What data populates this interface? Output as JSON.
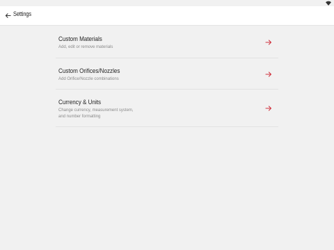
{
  "status_bar": {
    "icons": [
      "wifi-icon"
    ]
  },
  "app_bar": {
    "back_icon": "arrow-left-icon",
    "title": "Settings"
  },
  "settings": {
    "accent_color": "#d0313d",
    "items": [
      {
        "title": "Custom Materials",
        "description": "Add, edit or remove materials",
        "icon": "arrow-right-icon"
      },
      {
        "title": "Custom Orifices/Nozzles",
        "description": "Add Orifice/Nozzle combinations",
        "icon": "arrow-right-icon"
      },
      {
        "title": "Currency & Units",
        "description": "Change currency, measurement system,\nand number formatting",
        "icon": "arrow-right-icon"
      }
    ]
  }
}
